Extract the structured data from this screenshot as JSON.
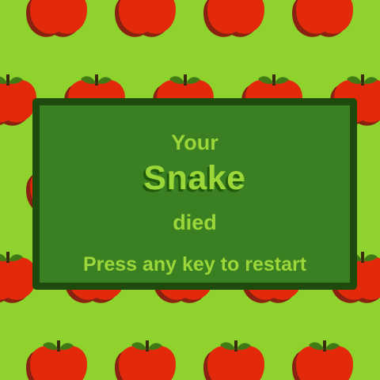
{
  "game": {
    "colors": {
      "background": "#8fd22e",
      "apple": "#e22a0a",
      "apple_shadow": "#8a2212",
      "leaf": "#3f7a16",
      "stem": "#3a2a10",
      "panel": "#3b7f23",
      "panel_border": "#1f4a0e",
      "text": "#9bd739",
      "title_shadow": "#1f5a0c"
    },
    "background_icon": "apple-icon",
    "game_over": {
      "line1": "Your",
      "title": "Snake",
      "line3": "died",
      "prompt": "Press any key to restart"
    }
  }
}
